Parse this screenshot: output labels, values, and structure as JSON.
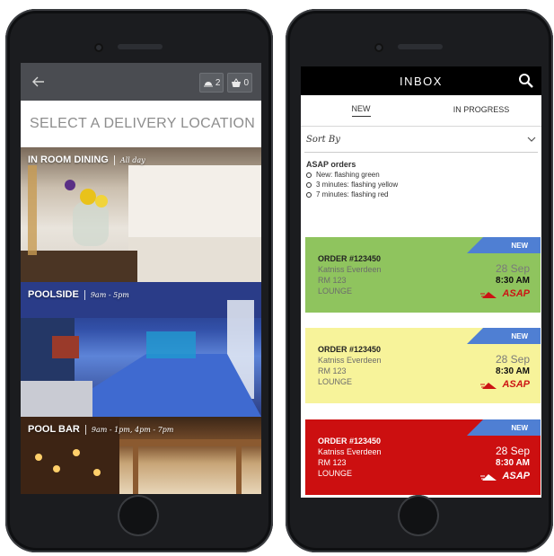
{
  "left_phone": {
    "badges": [
      {
        "icon": "tray-icon",
        "count": "2"
      },
      {
        "icon": "basket-icon",
        "count": "0"
      }
    ],
    "title": "SELECT A DELIVERY LOCATION",
    "locations": [
      {
        "name": "IN ROOM DINING",
        "hours": "All day"
      },
      {
        "name": "POOLSIDE",
        "hours": "9am - 5pm"
      },
      {
        "name": "POOL BAR",
        "hours": "9am - 1pm, 4pm - 7pm"
      }
    ]
  },
  "right_phone": {
    "header_title": "INBOX",
    "tabs": [
      {
        "label": "NEW",
        "active": true
      },
      {
        "label": "IN PROGRESS",
        "active": false
      }
    ],
    "sort_by": "Sort By",
    "asap_info": {
      "heading": "ASAP orders",
      "items": [
        "New: flashing green",
        "3 minutes: flashing yellow",
        "7 minutes: flashing red"
      ]
    },
    "orders": [
      {
        "tag": "NEW",
        "order_id": "ORDER #123450",
        "guest": "Katniss Everdeen",
        "room": "RM 123",
        "location": "LOUNGE",
        "date": "28 Sep",
        "time": "8:30 AM",
        "priority": "ASAP",
        "color": "#8fc45e"
      },
      {
        "tag": "NEW",
        "order_id": "ORDER #123450",
        "guest": "Katniss Everdeen",
        "room": "RM 123",
        "location": "LOUNGE",
        "date": "28 Sep",
        "time": "8:30 AM",
        "priority": "ASAP",
        "color": "#f7f39a"
      },
      {
        "tag": "NEW",
        "order_id": "ORDER #123450",
        "guest": "Katniss Everdeen",
        "room": "RM 123",
        "location": "LOUNGE",
        "date": "28 Sep",
        "time": "8:30 AM",
        "priority": "ASAP",
        "color": "#cc0f10"
      }
    ]
  },
  "colors": {
    "new_tag": "#4f7fd3",
    "asap_red": "#cc1414"
  }
}
